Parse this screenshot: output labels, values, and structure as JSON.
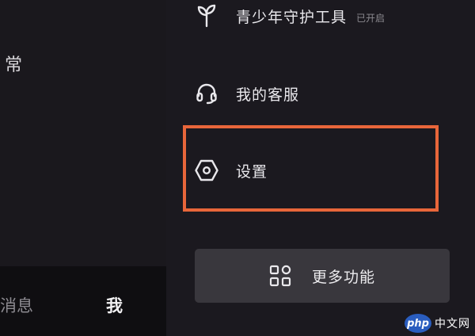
{
  "background_app": {
    "partial_text": "常",
    "bottom_nav": {
      "messages_label": "消息",
      "me_label": "我"
    }
  },
  "drawer": {
    "items": [
      {
        "label": "青少年守护工具",
        "badge": "已开启",
        "icon": "sprout-icon"
      },
      {
        "label": "我的客服",
        "icon": "headset-icon"
      },
      {
        "label": "设置",
        "icon": "hexagon-nut-icon"
      }
    ],
    "highlight_color": "#e8663a",
    "more_button": {
      "label": "更多功能",
      "icon": "grid-icon"
    }
  },
  "watermark": {
    "logo_text": "php",
    "site_text": "中文网"
  },
  "colors": {
    "background": "#161419",
    "drawer": "#1b191f",
    "button": "#39373d",
    "text": "#e9e8ec"
  }
}
